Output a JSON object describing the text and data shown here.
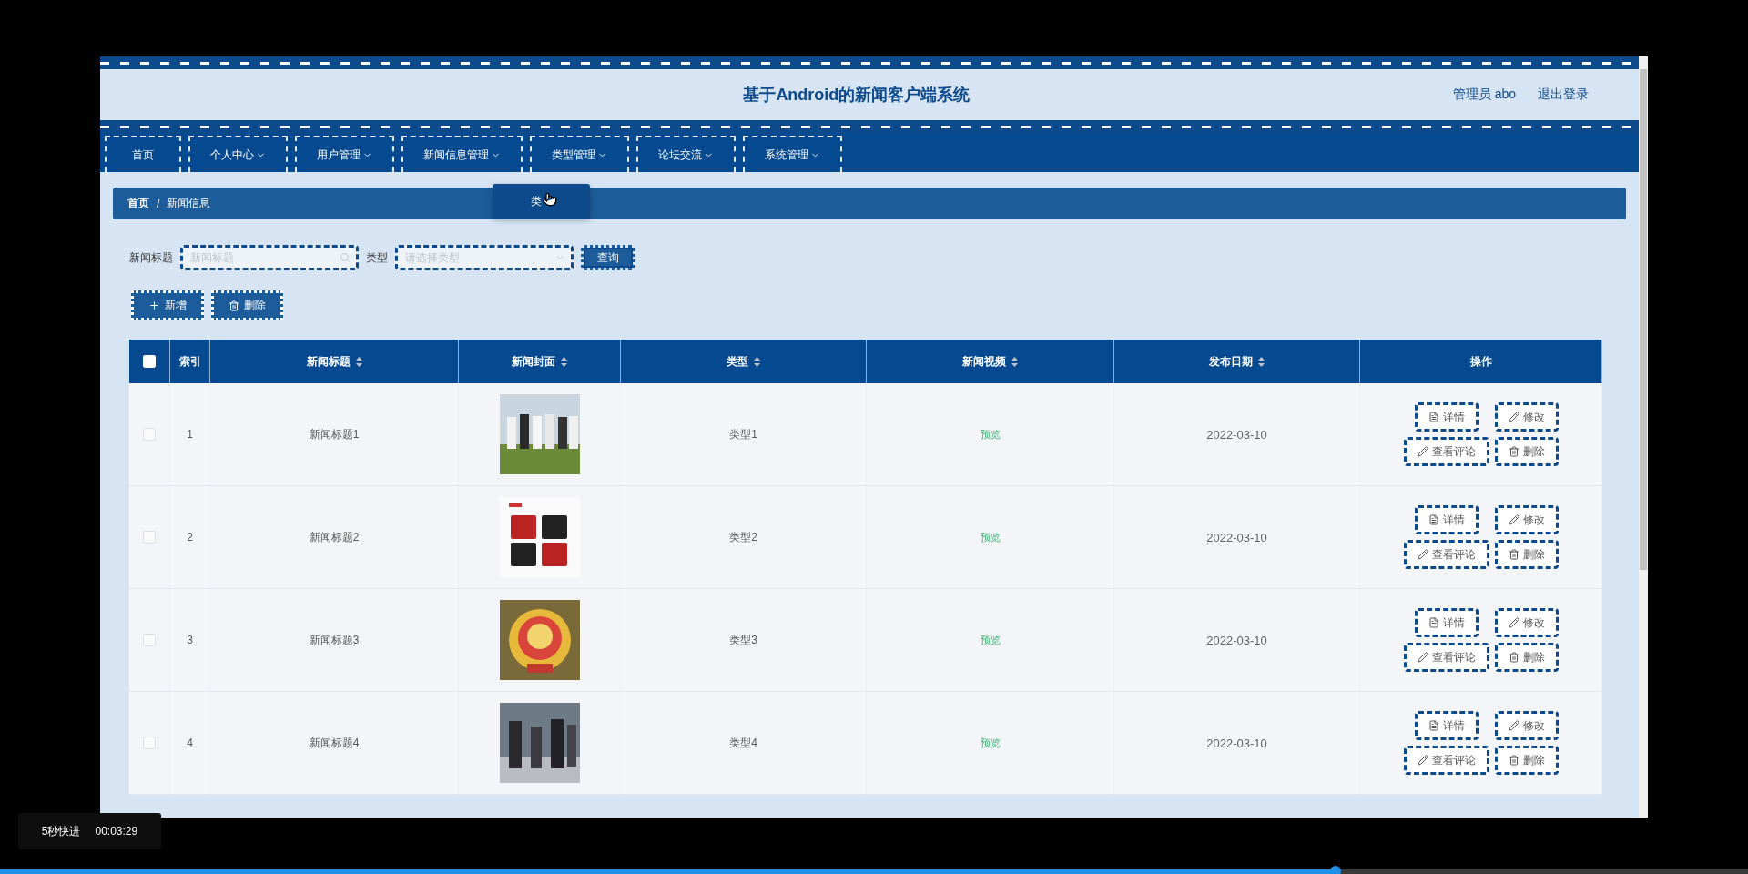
{
  "header": {
    "title": "基于Android的新闻客户端系统",
    "user": "管理员 abo",
    "logout": "退出登录"
  },
  "nav": [
    {
      "label": "首页",
      "dropdown": false
    },
    {
      "label": "个人中心",
      "dropdown": true
    },
    {
      "label": "用户管理",
      "dropdown": true
    },
    {
      "label": "新闻信息管理",
      "dropdown": true
    },
    {
      "label": "类型管理",
      "dropdown": true
    },
    {
      "label": "论坛交流",
      "dropdown": true
    },
    {
      "label": "系统管理",
      "dropdown": true
    }
  ],
  "dropdown_menu": {
    "item": "类"
  },
  "breadcrumb": {
    "items": [
      "首页",
      "新闻信息"
    ],
    "separator": "/"
  },
  "filters": {
    "title_label": "新闻标题",
    "title_placeholder": "新闻标题",
    "type_label": "类型",
    "type_placeholder": "请选择类型",
    "search_button": "查询"
  },
  "actions": [
    {
      "kind": "add",
      "label": "新增"
    },
    {
      "kind": "delete",
      "label": "删除"
    }
  ],
  "table": {
    "select_all": {
      "checked": false
    },
    "columns": [
      {
        "label": "索引",
        "sortable": false
      },
      {
        "label": "新闻标题",
        "sortable": true
      },
      {
        "label": "新闻封面",
        "sortable": true
      },
      {
        "label": "类型",
        "sortable": true
      },
      {
        "label": "新闻视频",
        "sortable": true
      },
      {
        "label": "发布日期",
        "sortable": true
      },
      {
        "label": "操作",
        "sortable": false
      }
    ],
    "rows": [
      {
        "checked": false,
        "index": "1",
        "title": "新闻标题1",
        "type": "类型1",
        "video": "预览",
        "date": "2022-03-10",
        "actions": [
          {
            "kind": "detail",
            "label": "详情"
          },
          {
            "kind": "edit",
            "label": "修改"
          },
          {
            "kind": "edit",
            "label": "查看评论"
          },
          {
            "kind": "delete",
            "label": "删除"
          }
        ]
      },
      {
        "checked": false,
        "index": "2",
        "title": "新闻标题2",
        "type": "类型2",
        "video": "预览",
        "date": "2022-03-10",
        "actions": [
          {
            "kind": "detail",
            "label": "详情"
          },
          {
            "kind": "edit",
            "label": "修改"
          },
          {
            "kind": "edit",
            "label": "查看评论"
          },
          {
            "kind": "delete",
            "label": "删除"
          }
        ]
      },
      {
        "checked": false,
        "index": "3",
        "title": "新闻标题3",
        "type": "类型3",
        "video": "预览",
        "date": "2022-03-10",
        "actions": [
          {
            "kind": "detail",
            "label": "详情"
          },
          {
            "kind": "edit",
            "label": "修改"
          },
          {
            "kind": "edit",
            "label": "查看评论"
          },
          {
            "kind": "delete",
            "label": "删除"
          }
        ]
      },
      {
        "checked": false,
        "index": "4",
        "title": "新闻标题4",
        "type": "类型4",
        "video": "预览",
        "date": "2022-03-10",
        "actions": [
          {
            "kind": "detail",
            "label": "详情"
          },
          {
            "kind": "edit",
            "label": "修改"
          },
          {
            "kind": "edit",
            "label": "查看评论"
          },
          {
            "kind": "delete",
            "label": "删除"
          }
        ]
      }
    ]
  },
  "player": {
    "hint": "5秒快进",
    "time": "00:03:29",
    "progress": {
      "level": 0.764
    }
  }
}
